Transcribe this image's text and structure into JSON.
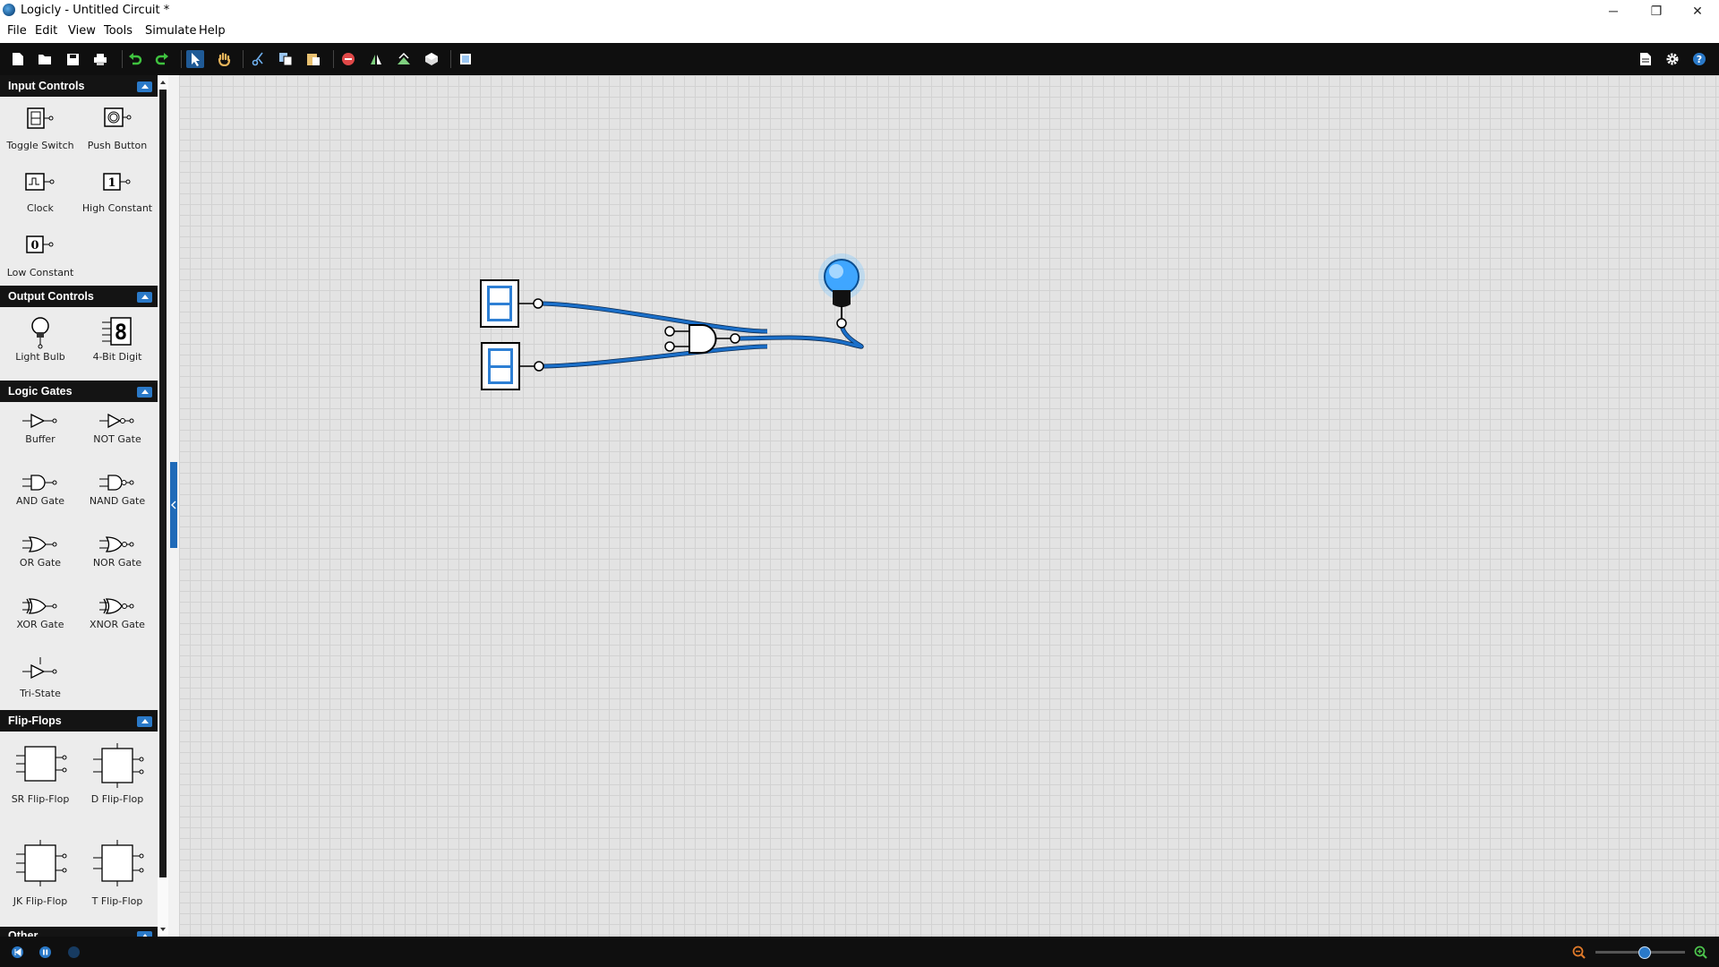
{
  "window": {
    "title": "Logicly - Untitled Circuit *",
    "minimize": "─",
    "restore": "❐",
    "close": "✕"
  },
  "menu": {
    "items": [
      "File",
      "Edit",
      "View",
      "Tools",
      "Simulate",
      "Help"
    ]
  },
  "toolbar": {
    "tools": [
      "new-icon",
      "open-icon",
      "save-icon",
      "print-icon",
      "undo-icon",
      "redo-icon",
      "select-icon",
      "pan-icon",
      "cut-icon",
      "copy-icon",
      "paste-icon",
      "delete-icon",
      "flip-horizontal-icon",
      "flip-vertical-icon",
      "rotate-icon",
      "grid-icon"
    ],
    "right_tools": [
      "page-icon",
      "settings-icon",
      "help-icon"
    ],
    "active_tool": "select-icon"
  },
  "sidebar": {
    "categories": [
      {
        "title": "Input Controls",
        "items": [
          "Toggle Switch",
          "Push Button",
          "Clock",
          "High Constant",
          "Low Constant"
        ]
      },
      {
        "title": "Output Controls",
        "items": [
          "Light Bulb",
          "4-Bit Digit"
        ]
      },
      {
        "title": "Logic Gates",
        "items": [
          "Buffer",
          "NOT Gate",
          "AND Gate",
          "NAND Gate",
          "OR Gate",
          "NOR Gate",
          "XOR Gate",
          "XNOR Gate",
          "Tri-State"
        ]
      },
      {
        "title": "Flip-Flops",
        "items": [
          "SR Flip-Flop",
          "D Flip-Flop",
          "JK Flip-Flop",
          "T Flip-Flop"
        ]
      },
      {
        "title": "Other",
        "items": []
      }
    ],
    "icon_text": {
      "high": "1",
      "low": "0",
      "digit": "8"
    }
  },
  "circuit": {
    "components": [
      "toggle-switch",
      "toggle-switch",
      "and-gate",
      "light-bulb"
    ],
    "bulb_state": "on",
    "wire_color": "#1a6fc9"
  },
  "statusbar": {
    "buttons": [
      "reset-icon",
      "pause-icon",
      "step-icon"
    ],
    "zoom_level": 0.55
  },
  "colors": {
    "accent": "#2a79c8",
    "header": "#141414",
    "canvas": "#e3e3e3"
  }
}
